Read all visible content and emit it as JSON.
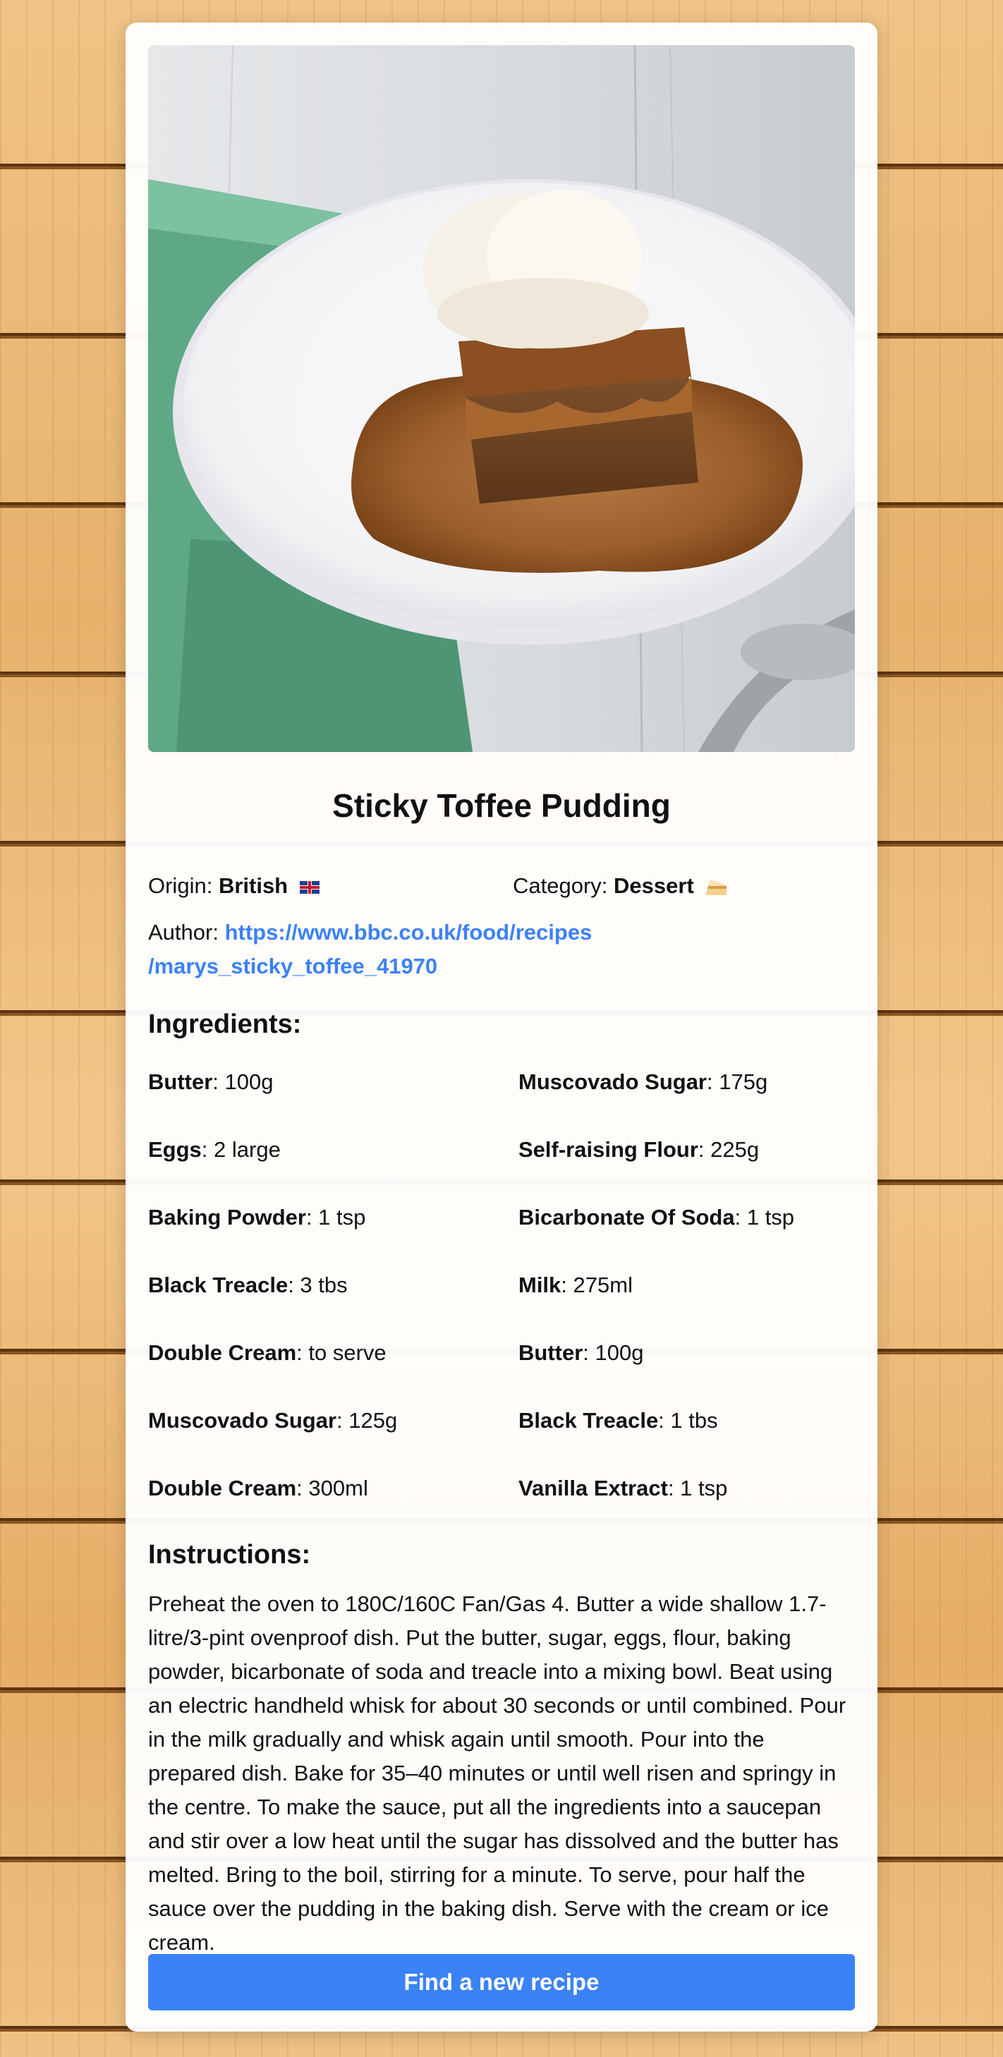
{
  "recipe": {
    "title": "Sticky Toffee Pudding",
    "origin_label": "Origin:",
    "origin_value": "British",
    "origin_icon": "uk-flag-icon",
    "category_label": "Category:",
    "category_value": "Dessert",
    "category_icon": "cake-icon",
    "author_label": "Author:",
    "author_url": "https://www.bbc.co.uk/food/recipes/marys_sticky_toffee_41970",
    "author_url_line1": "https://www.bbc.co.uk/food/recipes",
    "author_url_line2": "/marys_sticky_toffee_41970"
  },
  "ingredients_heading": "Ingredients:",
  "ingredients": [
    {
      "name": "Butter",
      "amount": ": 100g"
    },
    {
      "name": "Muscovado Sugar",
      "amount": ": 175g"
    },
    {
      "name": "Eggs",
      "amount": ": 2 large"
    },
    {
      "name": "Self-raising Flour",
      "amount": ": 225g"
    },
    {
      "name": "Baking Powder",
      "amount": ": 1 tsp"
    },
    {
      "name": "Bicarbonate Of Soda",
      "amount": ": 1 tsp"
    },
    {
      "name": "Black Treacle",
      "amount": ": 3 tbs"
    },
    {
      "name": "Milk",
      "amount": ": 275ml"
    },
    {
      "name": "Double Cream",
      "amount": ": to serve"
    },
    {
      "name": "Butter",
      "amount": ": 100g"
    },
    {
      "name": "Muscovado Sugar",
      "amount": ": 125g"
    },
    {
      "name": "Black Treacle",
      "amount": ": 1 tbs"
    },
    {
      "name": "Double Cream",
      "amount": ": 300ml"
    },
    {
      "name": "Vanilla Extract",
      "amount": ": 1 tsp"
    }
  ],
  "instructions_heading": "Instructions:",
  "instructions": "Preheat the oven to 180C/160C Fan/Gas 4. Butter a wide shallow 1.7-litre/3-pint ovenproof dish. Put the butter, sugar, eggs, flour, baking powder, bicarbonate of soda and treacle into a mixing bowl. Beat using an electric handheld whisk for about 30 seconds or until combined. Pour in the milk gradually and whisk again until smooth. Pour into the prepared dish. Bake for 35–40 minutes or until well risen and springy in the centre. To make the sauce, put all the ingredients into a saucepan and stir over a low heat until the sugar has dissolved and the butter has melted. Bring to the boil, stirring for a minute. To serve, pour half the sauce over the pudding in the baking dish. Serve with the cream or ice cream.",
  "button_label": "Find a new recipe",
  "colors": {
    "accent": "#3b82f6",
    "background_wood": "#e9b877"
  }
}
